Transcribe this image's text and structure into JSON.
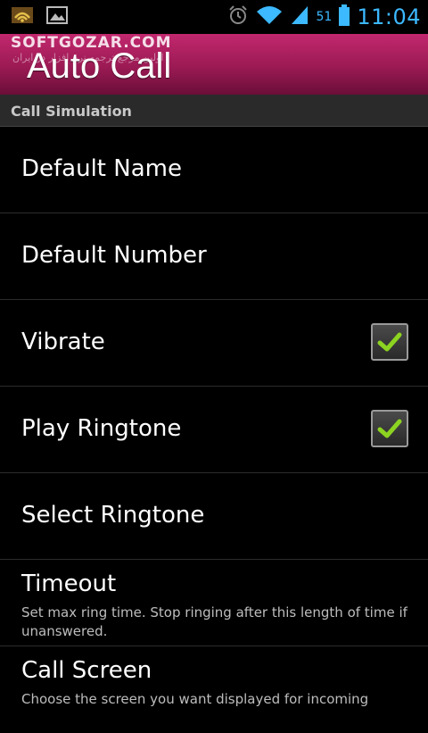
{
  "status_bar": {
    "time": "11:04",
    "battery_level": "51",
    "icons": [
      "wifi-notification-icon",
      "image-icon",
      "alarm-icon",
      "wifi-signal-icon",
      "cell-signal-icon",
      "battery-icon"
    ]
  },
  "title_bar": {
    "watermark": "SOFTGOZAR.COM",
    "watermark_sub": "اولین مرجع ترجمه نرم افزار در ایران",
    "title": "Auto Call",
    "background": "#9b1a54"
  },
  "section": {
    "header": "Call Simulation"
  },
  "settings": [
    {
      "title": "Default Name"
    },
    {
      "title": "Default Number"
    },
    {
      "title": "Vibrate",
      "checked": true
    },
    {
      "title": "Play Ringtone",
      "checked": true
    },
    {
      "title": "Select Ringtone"
    },
    {
      "title": "Timeout",
      "summary": "Set max ring time. Stop ringing after this length of time if unanswered."
    },
    {
      "title": "Call Screen",
      "summary": "Choose the screen you want displayed for incoming"
    }
  ],
  "colors": {
    "accent": "#3cb9ff",
    "check": "#8cd321"
  }
}
